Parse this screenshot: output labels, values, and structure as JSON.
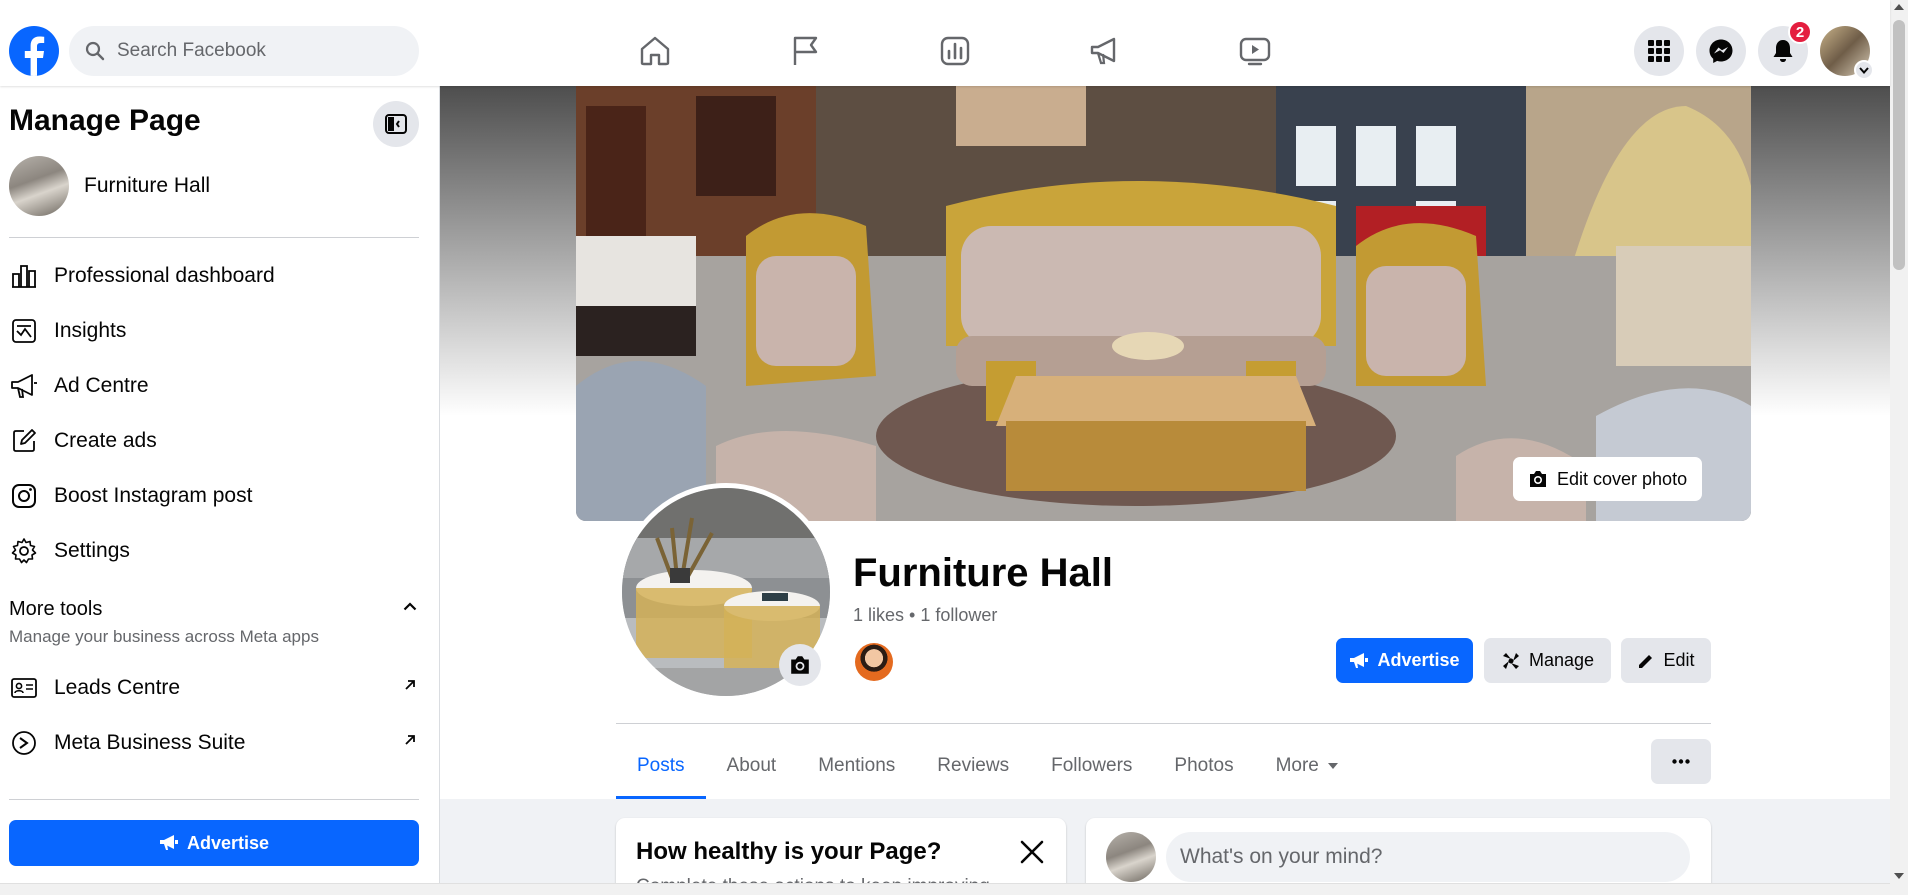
{
  "topbar": {
    "search_placeholder": "Search Facebook",
    "nav": [
      "home-icon",
      "pages-flag-icon",
      "insights-bar-chart-icon",
      "ads-megaphone-icon",
      "watch-video-icon"
    ],
    "notifications_count": "2"
  },
  "sidebar": {
    "title": "Manage Page",
    "page_name": "Furniture Hall",
    "items": [
      {
        "label": "Professional dashboard",
        "icon": "dashboard-icon"
      },
      {
        "label": "Insights",
        "icon": "insights-icon"
      },
      {
        "label": "Ad Centre",
        "icon": "megaphone-icon"
      },
      {
        "label": "Create ads",
        "icon": "pencil-square-icon"
      },
      {
        "label": "Boost Instagram post",
        "icon": "instagram-icon"
      },
      {
        "label": "Settings",
        "icon": "gear-icon"
      }
    ],
    "more_tools": {
      "heading": "More tools",
      "subtitle": "Manage your business across Meta apps",
      "items": [
        {
          "label": "Leads Centre",
          "icon": "contact-card-icon"
        },
        {
          "label": "Meta Business Suite",
          "icon": "meta-business-icon"
        }
      ]
    },
    "advertise_label": "Advertise"
  },
  "profile": {
    "edit_cover_label": "Edit cover photo",
    "name": "Furniture Hall",
    "stats": "1 likes • 1 follower",
    "buttons": {
      "advertise": "Advertise",
      "manage": "Manage",
      "edit": "Edit"
    }
  },
  "tabs": [
    "Posts",
    "About",
    "Mentions",
    "Reviews",
    "Followers",
    "Photos",
    "More"
  ],
  "active_tab": "Posts",
  "health_card": {
    "title": "How healthy is your Page?",
    "subtitle": "Complete these actions to keep improving"
  },
  "composer": {
    "placeholder": "What's on your mind?"
  },
  "colors": {
    "brand_blue": "#0866ff",
    "badge_red": "#e41e3f",
    "background": "#f0f2f5"
  }
}
